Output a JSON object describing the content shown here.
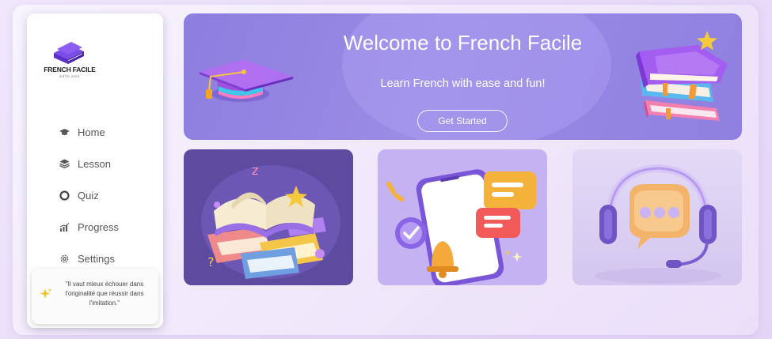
{
  "sidebar": {
    "logo_text": "FRENCH FACILE",
    "logo_subtext": "ESTD 2023",
    "items": [
      {
        "label": "Home",
        "icon": "graduation-cap-icon"
      },
      {
        "label": "Lesson",
        "icon": "layers-icon"
      },
      {
        "label": "Quiz",
        "icon": "circle-icon"
      },
      {
        "label": "Progress",
        "icon": "bar-chart-icon"
      },
      {
        "label": "Settings",
        "icon": "gear-icon"
      }
    ],
    "quote": "\"Il vaut mieux échouer dans l'originalité que réussir dans l'imitation.\""
  },
  "hero": {
    "title": "Welcome to French Facile",
    "subtitle": "Learn French with ease and fun!",
    "cta_label": "Get Started"
  },
  "colors": {
    "hero_bg": "#8d7ddf",
    "card_1_bg": "#5c4b9e",
    "card_2_bg": "#c5b2f2",
    "card_3_bg": "#e3daf6",
    "logo": "#6a3fd8"
  },
  "cards": [
    {
      "illustration": "open-book-stack-illustration"
    },
    {
      "illustration": "phone-notifications-illustration"
    },
    {
      "illustration": "headset-chat-illustration"
    }
  ]
}
